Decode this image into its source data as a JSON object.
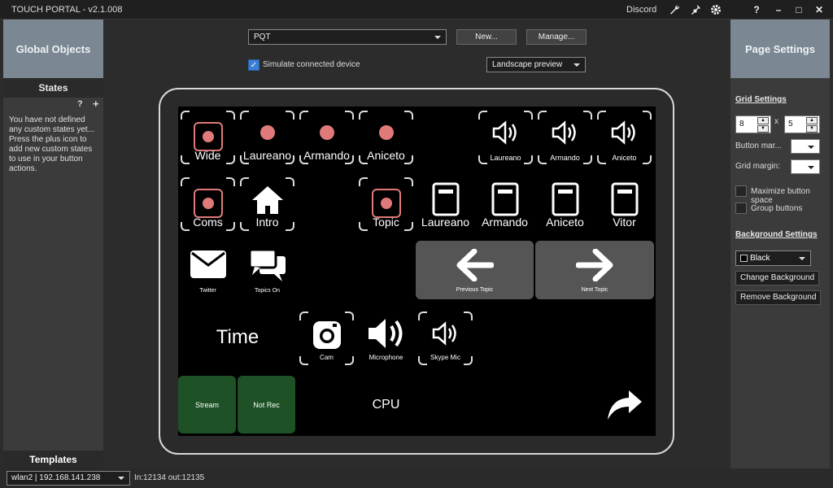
{
  "app": {
    "title": "TOUCH PORTAL - v2.1.008",
    "discord": "Discord",
    "help": "?",
    "minimize": "–",
    "maximize": "□",
    "close": "✕"
  },
  "left": {
    "header": "Global Objects",
    "states_title": "States",
    "help": "?",
    "add": "+",
    "message": "You have not defined any custom states yet... Press the plus icon to add new custom states to use in your button actions.",
    "templates": "Templates"
  },
  "top": {
    "page_select": "PQT",
    "new_btn": "New...",
    "manage_btn": "Manage...",
    "simulate_label": "Simulate connected device",
    "preview_select": "Landscape preview"
  },
  "right": {
    "header": "Page Settings",
    "grid_settings": "Grid Settings",
    "cols": "8",
    "x": "x",
    "rows": "5",
    "button_margin": "Button mar...",
    "grid_margin": "Grid margin:",
    "maximize": "Maximize button space",
    "group": "Group buttons",
    "bg_settings": "Background Settings",
    "bg_color": "Black",
    "change_bg": "Change Background",
    "remove_bg": "Remove Background"
  },
  "grid": {
    "wide": "Wide",
    "laureano": "Laureano",
    "armando": "Armando",
    "aniceto": "Aniceto",
    "vol_laureano": "Laureano",
    "vol_armando": "Armando",
    "vol_aniceto": "Aniceto",
    "coms": "Coms",
    "intro": "Intro",
    "topic": "Topic",
    "doc_laureano": "Laureano",
    "doc_armando": "Armando",
    "doc_aniceto": "Aniceto",
    "doc_vitor": "Vitor",
    "twitter": "Twitter",
    "topics_on": "Topics On",
    "prev_topic": "Previous Topic",
    "next_topic": "Next Topic",
    "time": "Time",
    "cam": "Cam",
    "microphone": "Microphone",
    "skype_mic": "Skype Mic",
    "stream": "Stream",
    "not_rec": "Not Rec",
    "cpu": "CPU"
  },
  "status": {
    "network": "wlan2 | 192.168.141.238",
    "io": "In:12134 out:12135"
  }
}
